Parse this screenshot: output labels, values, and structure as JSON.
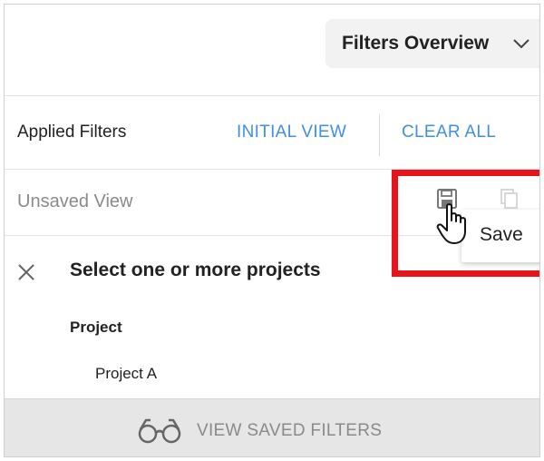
{
  "header": {
    "view_select_label": "Filters Overview",
    "view_select_icon": "chevron-down-icon"
  },
  "applied_filters": {
    "title": "Applied Filters",
    "initial_view_label": "INITIAL VIEW",
    "clear_all_label": "CLEAR ALL",
    "link_color": "#3f8fe8"
  },
  "view_row": {
    "status_text": "Unsaved View",
    "save_icon": "floppy-disk-icon",
    "copy_icon": "copy-icon",
    "tooltip": "Save"
  },
  "project_filter": {
    "close_icon": "close-icon",
    "title": "Select one or more projects",
    "field_label": "Project",
    "items": [
      "Project A"
    ]
  },
  "footer": {
    "icon": "glasses-icon",
    "label": "VIEW SAVED FILTERS"
  },
  "highlight_color": "#e8141b"
}
